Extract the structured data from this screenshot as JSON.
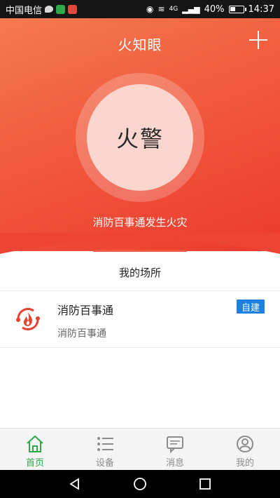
{
  "status_bar": {
    "carrier": "中国电信",
    "battery": "40%",
    "time": "14:37",
    "signal": "4G"
  },
  "header": {
    "title": "火知眼"
  },
  "alarm": {
    "button_label": "火警",
    "message": "消防百事通发生火灾"
  },
  "tab": {
    "label": "我的场所"
  },
  "places": [
    {
      "name": "消防百事通",
      "subtitle": "消防百事通",
      "badge": "自建",
      "icon": "fire-logo-icon"
    }
  ],
  "bottom_nav": [
    {
      "label": "首页",
      "icon": "home-icon",
      "active": true
    },
    {
      "label": "设备",
      "icon": "list-icon",
      "active": false
    },
    {
      "label": "消息",
      "icon": "message-icon",
      "active": false
    },
    {
      "label": "我的",
      "icon": "user-icon",
      "active": false
    }
  ],
  "colors": {
    "accent": "#ef5a3f",
    "active_tab": "#2fa84a",
    "badge": "#1e7fe0"
  }
}
